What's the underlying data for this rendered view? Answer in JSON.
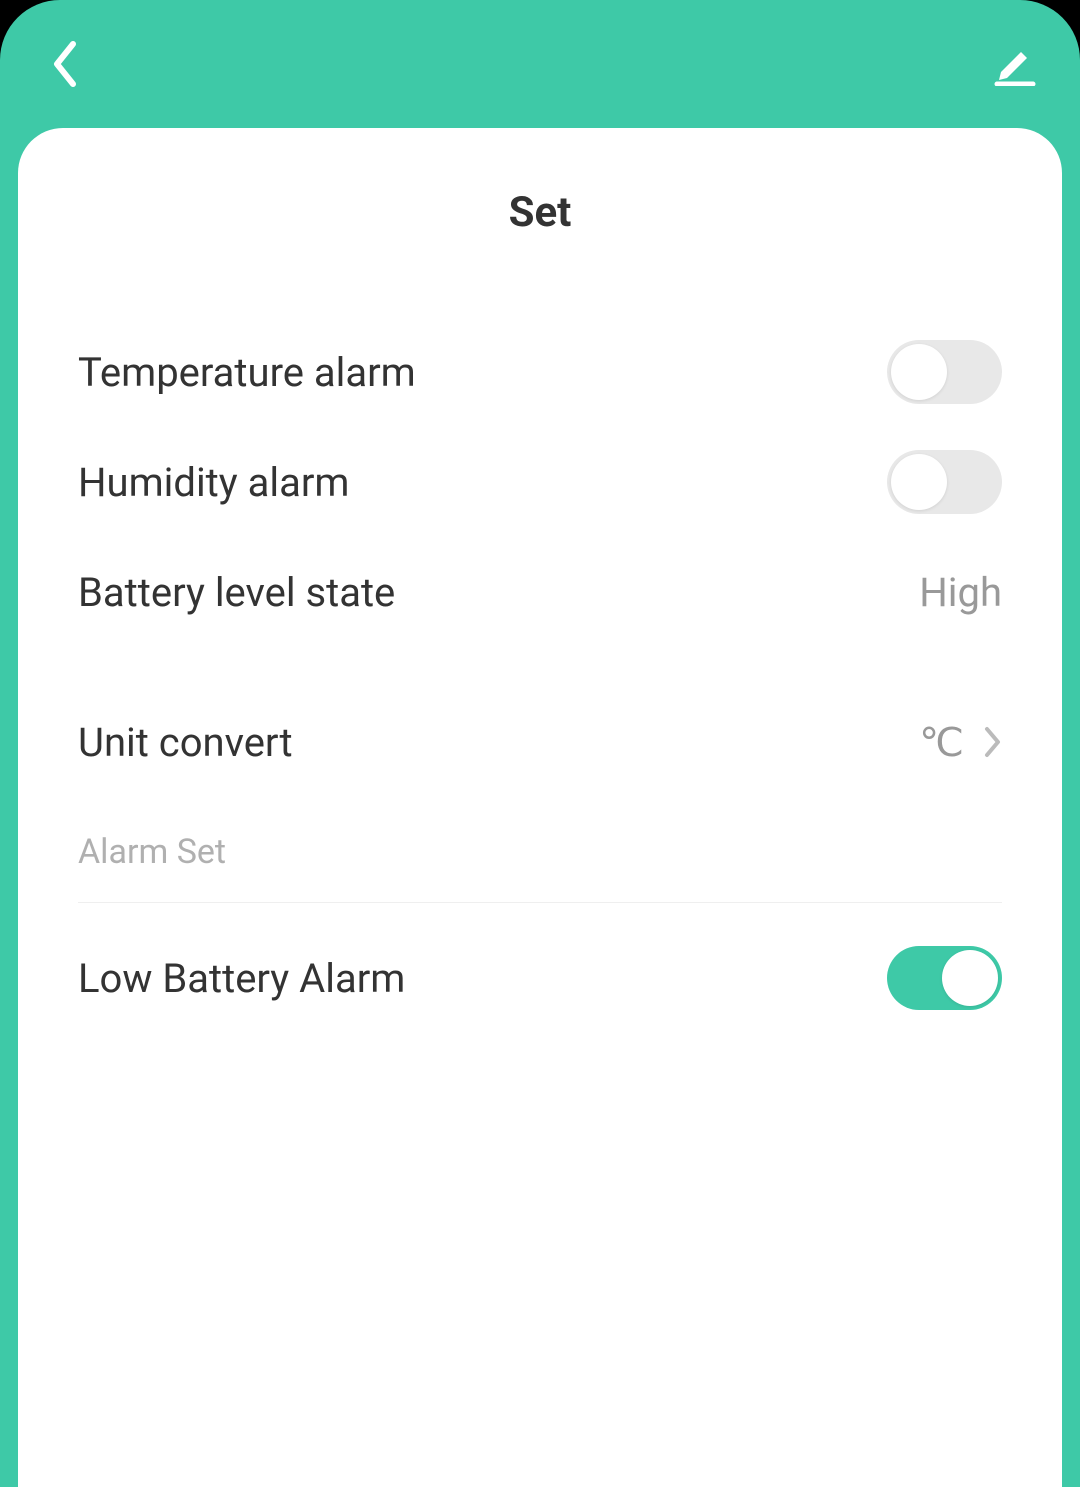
{
  "page": {
    "title": "Set"
  },
  "settings": {
    "temperature_alarm": {
      "label": "Temperature alarm",
      "enabled": false
    },
    "humidity_alarm": {
      "label": "Humidity alarm",
      "enabled": false
    },
    "battery_level_state": {
      "label": "Battery level state",
      "value": "High"
    },
    "unit_convert": {
      "label": "Unit convert",
      "value": "℃"
    }
  },
  "section": {
    "alarm_set": {
      "title": "Alarm Set"
    }
  },
  "alarm_settings": {
    "low_battery_alarm": {
      "label": "Low Battery Alarm",
      "enabled": true
    }
  }
}
